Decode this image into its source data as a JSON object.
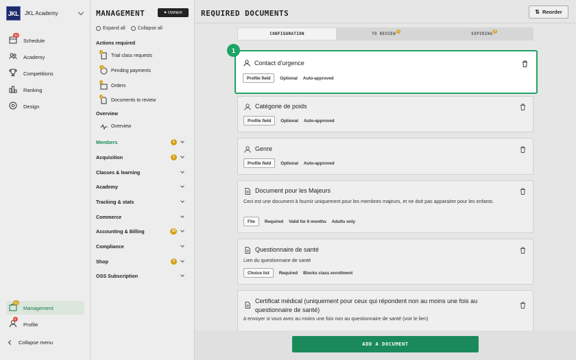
{
  "brand": {
    "logo": "JKL",
    "name": "JKL Academy"
  },
  "leftnav": {
    "items": [
      {
        "label": "Schedule",
        "icon": "calendar-icon",
        "badge": "20"
      },
      {
        "label": "Academy",
        "icon": "people-icon",
        "badge": ""
      },
      {
        "label": "Competitions",
        "icon": "trophy-icon",
        "badge": ""
      },
      {
        "label": "Ranking",
        "icon": "ranking-icon",
        "badge": ""
      },
      {
        "label": "Design",
        "icon": "palette-icon",
        "badge": ""
      }
    ],
    "management": {
      "label": "Management",
      "badge": "22"
    },
    "profile": {
      "label": "Profile",
      "badge": "9"
    },
    "collapse": "Collapse menu"
  },
  "panel": {
    "title": "MANAGEMENT",
    "owner": "OWNER",
    "expand_all": "Expand all",
    "collapse_all": "Collapse all",
    "actions_title": "Actions required",
    "actions": [
      {
        "label": "Trial class requests",
        "badge": "4"
      },
      {
        "label": "Pending payments",
        "badge": "10"
      },
      {
        "label": "Orders",
        "badge": "2"
      },
      {
        "label": "Documents to review",
        "badge": "1"
      }
    ],
    "overview_title": "Overview",
    "overview_item": "Overview",
    "groups": [
      {
        "label": "Members",
        "badge": "1"
      },
      {
        "label": "Acquisition",
        "badge": "1"
      },
      {
        "label": "Classes & learning",
        "badge": ""
      },
      {
        "label": "Academy",
        "badge": ""
      },
      {
        "label": "Tracking & stats",
        "badge": ""
      },
      {
        "label": "Commerce",
        "badge": ""
      },
      {
        "label": "Accounting & Billing",
        "badge": "10"
      },
      {
        "label": "Compliance",
        "badge": ""
      },
      {
        "label": "Shop",
        "badge": "2"
      },
      {
        "label": "OSS Subscription",
        "badge": ""
      }
    ]
  },
  "main": {
    "title": "REQUIRED DOCUMENTS",
    "reorder": "Reorder",
    "tabs": [
      {
        "label": "CONFIGURATION",
        "badge": ""
      },
      {
        "label": "TO REVIEW",
        "badge": "1"
      },
      {
        "label": "EXPIRING",
        "badge": "2"
      }
    ],
    "highlight_number": "1",
    "cards": [
      {
        "title": "Contact d'urgence",
        "desc": "",
        "tags": [
          "Profile field",
          "Optional",
          "Auto-approved"
        ]
      },
      {
        "title": "Catégorie de poids",
        "desc": "",
        "tags": [
          "Profile field",
          "Optional",
          "Auto-approved"
        ]
      },
      {
        "title": "Genre",
        "desc": "",
        "tags": [
          "Profile field",
          "Optional",
          "Auto-approved"
        ]
      },
      {
        "title": "Document pour les Majeurs",
        "desc": "Ceci est une document à fournir uniquement pour les membres majeurs, et ne doit pas apparaitre pour les enfants.",
        "tags": [
          "File",
          "Required",
          "Valid for 6 months",
          "Adults only"
        ]
      },
      {
        "title": "Questionnaire de santé",
        "desc": "Lien du questionnaire de santé",
        "tags": [
          "Choice list",
          "Required",
          "Blocks class enrollment"
        ]
      },
      {
        "title": "Certificat médical (uniquement pour ceux qui répondent non au moins une fois au questionnaire de santé)",
        "desc": "à envoyer si vous avez au moins une fois non au questionnaire de santé (voir le lien)",
        "tags": []
      }
    ],
    "add_button": "ADD A DOCUMENT"
  }
}
